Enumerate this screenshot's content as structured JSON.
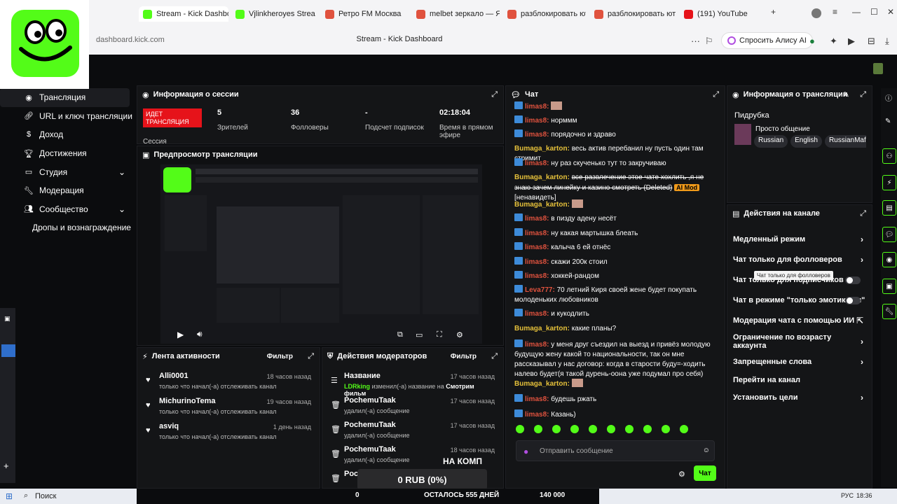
{
  "browser": {
    "tabs": [
      {
        "label": "Stream - Kick Dashbo",
        "color": "#53fc18"
      },
      {
        "label": "Vjlinkheroyes Stream - W",
        "color": "#53fc18"
      },
      {
        "label": "Ретро FM Москва",
        "color": "#e0523e"
      },
      {
        "label": "melbet зеркало — Яндекс",
        "color": "#e0523e"
      },
      {
        "label": "разблокировать ютуб в",
        "color": "#e0523e"
      },
      {
        "label": "разблокировать ютуб -",
        "color": "#e0523e"
      },
      {
        "label": "(191) YouTube",
        "color": "#e6131a"
      }
    ],
    "url": "dashboard.kick.com",
    "page_title": "Stream - Kick Dashboard",
    "alice": "Спросить Алису AI"
  },
  "sidebar": {
    "items": [
      {
        "label": "Трансляция",
        "icon": "broadcast-icon"
      },
      {
        "label": "URL и ключ трансляции",
        "icon": "link-icon"
      },
      {
        "label": "Доход",
        "icon": "money-icon"
      },
      {
        "label": "Достижения",
        "icon": "trophy-icon"
      },
      {
        "label": "Студия",
        "icon": "studio-icon"
      },
      {
        "label": "Модерация",
        "icon": "wrench-icon"
      },
      {
        "label": "Сообщество",
        "icon": "community-icon"
      },
      {
        "label": "Дропы и вознаграждение",
        "icon": ""
      }
    ]
  },
  "session": {
    "title": "Информация о сессии",
    "live": "ИДЕТ ТРАНСЛЯЦИЯ",
    "session_label": "Сессия",
    "stats": [
      {
        "value": "5",
        "label": "Зрителей"
      },
      {
        "value": "36",
        "label": "Фолловеры"
      },
      {
        "value": "-",
        "label": "Подсчет подписок"
      },
      {
        "value": "02:18:04",
        "label": "Время в прямом эфире"
      }
    ]
  },
  "preview": {
    "title": "Предпросмотр трансляции"
  },
  "activity": {
    "title": "Лента активности",
    "filter": "Фильтр",
    "items": [
      {
        "name": "Alli0001",
        "sub": "только что начал(-а) отслеживать канал",
        "time": "18 часов назад"
      },
      {
        "name": "MichurinoTema",
        "sub": "только что начал(-а) отслеживать канал",
        "time": "19 часов назад"
      },
      {
        "name": "asviq",
        "sub": "только что начал(-а) отслеживать канал",
        "time": "1 день назад"
      }
    ]
  },
  "mods": {
    "title": "Действия модераторов",
    "filter": "Фильтр",
    "items": [
      {
        "name": "Название",
        "sub_user": "LDRking",
        "sub": "изменил(-а) название на",
        "sub_bold": "Смотрим фильм",
        "time": "17 часов назад"
      },
      {
        "name": "PochemuTaak",
        "sub": "удалил(-а) сообщение",
        "time": "17 часов назад"
      },
      {
        "name": "PochemuTaak",
        "sub": "удалил(-а) сообщение",
        "time": "17 часов назад"
      },
      {
        "name": "PochemuTaak",
        "sub": "удалил(-а) сообщение",
        "time": "18 часов назад"
      },
      {
        "name": "Poch",
        "sub": "",
        "time": ""
      }
    ]
  },
  "chat": {
    "title": "Чат",
    "placeholder": "Отправить сообщение",
    "send": "Чат",
    "messages": [
      {
        "user": "limas8",
        "text": "",
        "uc": "red"
      },
      {
        "user": "limas8",
        "text": "норммм",
        "uc": "red"
      },
      {
        "user": "limas8",
        "text": "порядочно и здраво",
        "uc": "red"
      },
      {
        "user": "Bumaga_karton",
        "text": "весь актив перебанил ну пусть один там стримит",
        "uc": "yel"
      },
      {
        "user": "limas8",
        "text": "ну раз скученько тут то закручиваю",
        "uc": "red"
      },
      {
        "user": "Bumaga_karton",
        "text": "все развлечение этое чате хохлить ,я не знаю зачем линейку и казино смотреть (Deleted)",
        "uc": "yel",
        "del": true
      },
      {
        "user": "Bumaga_karton",
        "text": "",
        "uc": "yel"
      },
      {
        "user": "limas8",
        "text": "в пизду адену несёт",
        "uc": "red"
      },
      {
        "user": "limas8",
        "text": "ну какая мартышка блеать",
        "uc": "red"
      },
      {
        "user": "limas8",
        "text": "калыча 6 ей отнёс",
        "uc": "red"
      },
      {
        "user": "limas8",
        "text": "скажи 200к стоил",
        "uc": "red"
      },
      {
        "user": "limas8",
        "text": "хоккей-рандом",
        "uc": "red"
      },
      {
        "user": "Leva777",
        "text": "70 летний Киря своей жене будет покупать молоденьких любовников",
        "uc": "red2"
      },
      {
        "user": "limas8",
        "text": "и кукодлить",
        "uc": "red"
      },
      {
        "user": "Bumaga_karton",
        "text": "какие планы?",
        "uc": "yel"
      },
      {
        "user": "limas8",
        "text": "у меня друг съездил на выезд и привёз молодую будущую жену какой то национальности, так он мне рассказывал у нас договор: когда в старости буду=-ходить налево будет(я такой дурень-оона уже подумал про себя)",
        "uc": "red"
      },
      {
        "user": "Bumaga_karton",
        "text": "",
        "uc": "yel"
      },
      {
        "user": "limas8",
        "text": "будешь ржать",
        "uc": "red"
      },
      {
        "user": "limas8",
        "text": "Казань)",
        "uc": "red"
      }
    ],
    "ai_mod": "AI Mod",
    "ai_tail": "[ненавидеть]"
  },
  "info": {
    "title": "Информация о трансляции",
    "stream_title": "Пидрубка",
    "category": "Просто общение",
    "tags": [
      "Russian",
      "English",
      "RussianMafia"
    ]
  },
  "channel": {
    "title": "Действия на канале",
    "tooltip": "Чат только для фолловеров",
    "items": [
      {
        "label": "Медленный режим",
        "kind": "chev"
      },
      {
        "label": "Чат только для фолловеров",
        "kind": "chev"
      },
      {
        "label": "Чат только для подписчиков",
        "kind": "toggle"
      },
      {
        "label": "Чат в режиме \"только эмотиконы\"",
        "kind": "toggle"
      },
      {
        "label": "Модерация чата с помощью ИИ",
        "kind": "ext"
      },
      {
        "label": "Ограничение по возрасту аккаунта",
        "kind": "chev"
      },
      {
        "label": "Запрещенные слова",
        "kind": "chev"
      },
      {
        "label": "Перейти на канал",
        "kind": "none"
      },
      {
        "label": "Установить цели",
        "kind": "chev"
      }
    ]
  },
  "overlay": {
    "rub": "0 RUB (0%)",
    "left": "0",
    "mid": "ОСТАЛОСЬ 555 ДНЕЙ",
    "right": "140 000",
    "na_komp": "НА КОМП"
  },
  "taskbar": {
    "search": "Поиск",
    "lang": "РУС",
    "time": "18:36"
  }
}
